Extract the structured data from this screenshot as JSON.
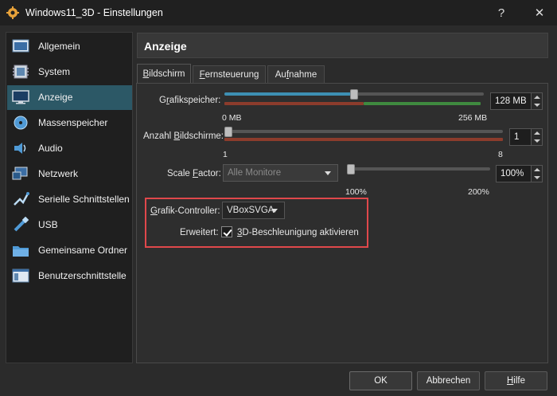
{
  "window": {
    "title": "Windows11_3D - Einstellungen",
    "help_glyph": "?",
    "close_glyph": "✕"
  },
  "sidebar": {
    "items": [
      {
        "label": "Allgemein",
        "icon": "general-icon"
      },
      {
        "label": "System",
        "icon": "system-chip-icon"
      },
      {
        "label": "Anzeige",
        "icon": "display-monitor-icon",
        "active": true
      },
      {
        "label": "Massenspeicher",
        "icon": "storage-disk-icon"
      },
      {
        "label": "Audio",
        "icon": "audio-speaker-icon"
      },
      {
        "label": "Netzwerk",
        "icon": "network-icon"
      },
      {
        "label": "Serielle Schnittstellen",
        "icon": "serial-port-icon"
      },
      {
        "label": "USB",
        "icon": "usb-icon"
      },
      {
        "label": "Gemeinsame Ordner",
        "icon": "shared-folder-icon"
      },
      {
        "label": "Benutzerschnittstelle",
        "icon": "user-interface-icon"
      }
    ]
  },
  "header": {
    "title": "Anzeige"
  },
  "tabs": [
    {
      "label_pre": "",
      "label_u": "B",
      "label_post": "ildschirm",
      "active": true
    },
    {
      "label_pre": "",
      "label_u": "F",
      "label_post": "ernsteuerung",
      "active": false
    },
    {
      "label_pre": "Au",
      "label_u": "f",
      "label_post": "nahme",
      "active": false
    }
  ],
  "screen": {
    "video_memory": {
      "label_pre": "G",
      "label_u": "r",
      "label_post": "afikspeicher:",
      "value": "128 MB",
      "min_label": "0 MB",
      "max_label": "256 MB",
      "fraction": 0.5
    },
    "monitor_count": {
      "label_pre": "Anzahl ",
      "label_u": "B",
      "label_post": "ildschirme:",
      "value": "1",
      "min_label": "1",
      "max_label": "8",
      "fraction": 0.0
    },
    "scale_factor": {
      "label_pre": "Scale ",
      "label_u": "F",
      "label_post": "actor:",
      "combo_value": "Alle Monitore",
      "value": "100%",
      "min_label": "100%",
      "max_label": "200%",
      "fraction": 0.0
    },
    "graphics_controller": {
      "label_pre": "",
      "label_u": "G",
      "label_post": "rafik-Controller:",
      "value": "VBoxSVGA"
    },
    "extended": {
      "label": "Erweitert:",
      "checkbox_label_pre": "",
      "checkbox_label_u": "3",
      "checkbox_label_post": "D-Beschleunigung aktivieren",
      "checked": true
    }
  },
  "footer": {
    "ok": "OK",
    "cancel": "Abbrechen",
    "help_pre": "",
    "help_u": "H",
    "help_post": "ilfe"
  },
  "colors": {
    "accent": "#3d8fb3",
    "sidebar_active": "#2c5866",
    "highlight_box": "#e0484b",
    "scale_red": "#8c3c2c",
    "scale_green": "#3f8a3f"
  }
}
